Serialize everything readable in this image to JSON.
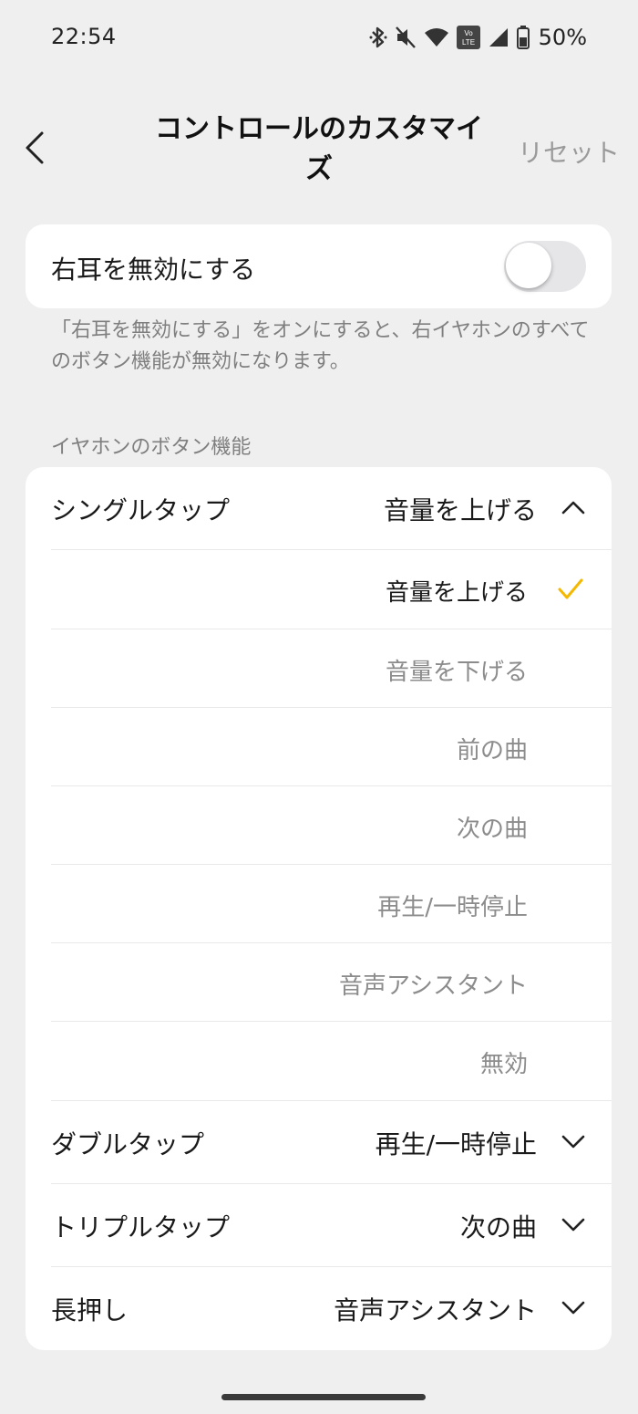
{
  "status_bar": {
    "time": "22:54",
    "icons": [
      "bluetooth-icon",
      "mute-icon",
      "wifi-icon",
      "volte-icon",
      "signal-icon",
      "battery-icon"
    ],
    "volte_text": "Vo LTE",
    "battery": "50%"
  },
  "header": {
    "title": "コントロールのカスタマイズ",
    "reset": "リセット"
  },
  "disable_card": {
    "label": "右耳を無効にする",
    "toggle_on": false,
    "note": "「右耳を無効にする」をオンにすると、右イヤホンのすべてのボタン機能が無効になります。"
  },
  "section": {
    "label": "イヤホンのボタン機能"
  },
  "functions": {
    "single_tap": {
      "label": "シングルタップ",
      "value": "音量を上げる",
      "expanded": true,
      "options": [
        {
          "label": "音量を上げる",
          "selected": true
        },
        {
          "label": "音量を下げる",
          "selected": false
        },
        {
          "label": "前の曲",
          "selected": false
        },
        {
          "label": "次の曲",
          "selected": false
        },
        {
          "label": "再生/一時停止",
          "selected": false
        },
        {
          "label": "音声アシスタント",
          "selected": false
        },
        {
          "label": "無効",
          "selected": false
        }
      ]
    },
    "double_tap": {
      "label": "ダブルタップ",
      "value": "再生/一時停止"
    },
    "triple_tap": {
      "label": "トリプルタップ",
      "value": "次の曲"
    },
    "long_press": {
      "label": "長押し",
      "value": "音声アシスタント"
    }
  },
  "colors": {
    "background": "#efefef",
    "card": "#ffffff",
    "accent_check": "#f5b800",
    "muted_text": "#8c8c8c"
  }
}
